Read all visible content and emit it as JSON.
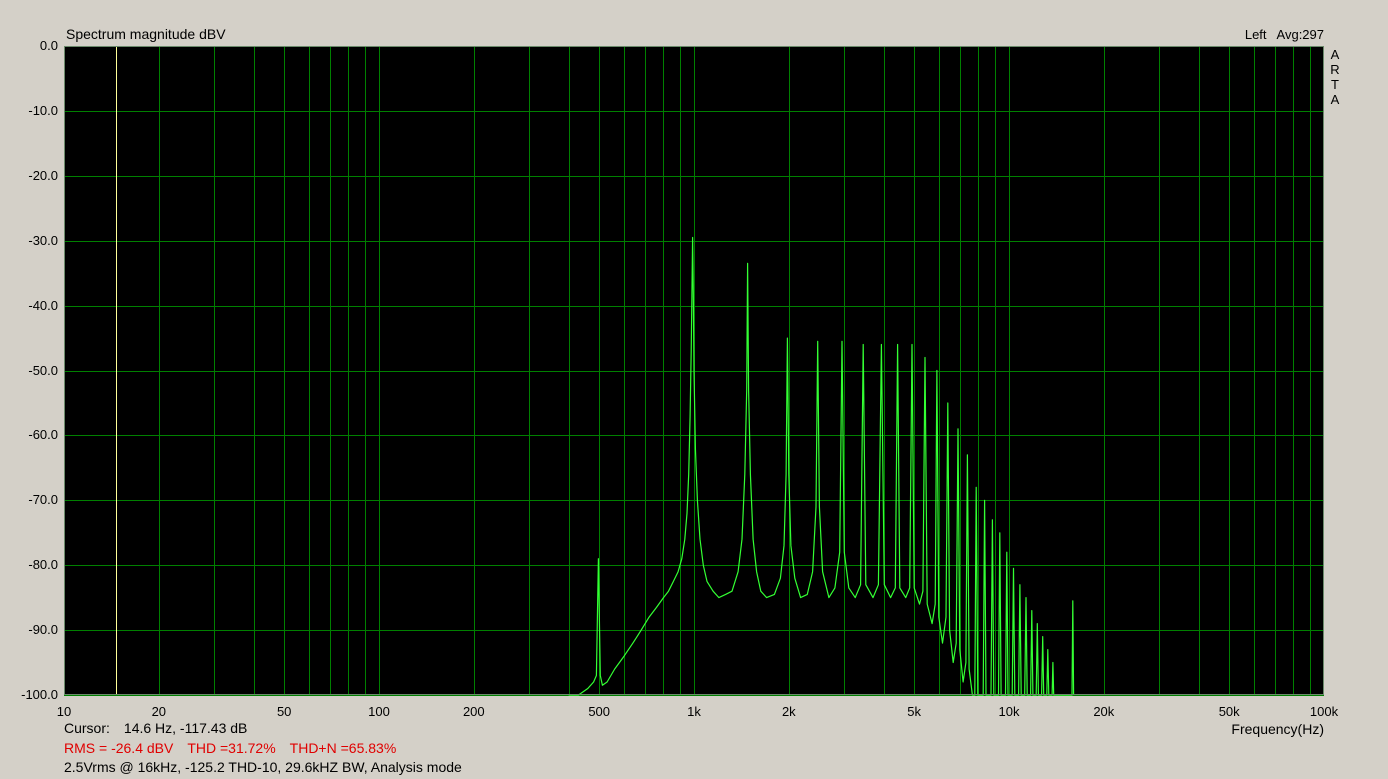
{
  "chart_data": {
    "type": "line",
    "title": "Spectrum magnitude dBV",
    "header_right": {
      "channel": "Left",
      "avg": "Avg:297"
    },
    "brand_vertical": [
      "A",
      "R",
      "T",
      "A"
    ],
    "xlabel": "Frequency(Hz)",
    "ylabel": "",
    "x_scale": "log",
    "xlim": [
      10,
      100000
    ],
    "ylim": [
      -100,
      0
    ],
    "x_ticks": [
      {
        "value": 10,
        "label": "10"
      },
      {
        "value": 20,
        "label": "20"
      },
      {
        "value": 50,
        "label": "50"
      },
      {
        "value": 100,
        "label": "100"
      },
      {
        "value": 200,
        "label": "200"
      },
      {
        "value": 500,
        "label": "500"
      },
      {
        "value": 1000,
        "label": "1k"
      },
      {
        "value": 2000,
        "label": "2k"
      },
      {
        "value": 5000,
        "label": "5k"
      },
      {
        "value": 10000,
        "label": "10k"
      },
      {
        "value": 20000,
        "label": "20k"
      },
      {
        "value": 50000,
        "label": "50k"
      },
      {
        "value": 100000,
        "label": "100k"
      }
    ],
    "y_ticks": [
      {
        "value": 0,
        "label": "0.0"
      },
      {
        "value": -10,
        "label": "-10.0"
      },
      {
        "value": -20,
        "label": "-20.0"
      },
      {
        "value": -30,
        "label": "-30.0"
      },
      {
        "value": -40,
        "label": "-40.0"
      },
      {
        "value": -50,
        "label": "-50.0"
      },
      {
        "value": -60,
        "label": "-60.0"
      },
      {
        "value": -70,
        "label": "-70.0"
      },
      {
        "value": -80,
        "label": "-80.0"
      },
      {
        "value": -90,
        "label": "-90.0"
      },
      {
        "value": -100,
        "label": "-100.0"
      }
    ],
    "grid": true,
    "cursor_frequency": 14.6,
    "colors": {
      "background": "#000000",
      "grid": "#008000",
      "trace": "#33ff33",
      "cursor": "#ffff99",
      "window": "#d4d0c8",
      "stats_text": "#e00000"
    },
    "series": [
      {
        "values": [
          [
            400,
            -100
          ],
          [
            430,
            -100
          ],
          [
            460,
            -99
          ],
          [
            480,
            -98
          ],
          [
            490,
            -97
          ],
          [
            497,
            -79
          ],
          [
            504,
            -97
          ],
          [
            512,
            -98.5
          ],
          [
            530,
            -98
          ],
          [
            560,
            -96
          ],
          [
            600,
            -94
          ],
          [
            640,
            -92
          ],
          [
            680,
            -90
          ],
          [
            720,
            -88
          ],
          [
            760,
            -86.5
          ],
          [
            800,
            -85
          ],
          [
            830,
            -84
          ],
          [
            860,
            -82.5
          ],
          [
            890,
            -81
          ],
          [
            915,
            -79
          ],
          [
            935,
            -76
          ],
          [
            950,
            -72
          ],
          [
            962,
            -66
          ],
          [
            972,
            -57
          ],
          [
            980,
            -47
          ],
          [
            985,
            -38.5
          ],
          [
            990,
            -29.5
          ],
          [
            995,
            -38
          ],
          [
            1000,
            -50
          ],
          [
            1010,
            -62
          ],
          [
            1025,
            -70
          ],
          [
            1045,
            -76
          ],
          [
            1070,
            -80
          ],
          [
            1100,
            -82.5
          ],
          [
            1150,
            -84
          ],
          [
            1200,
            -85
          ],
          [
            1260,
            -84.5
          ],
          [
            1320,
            -84
          ],
          [
            1380,
            -81
          ],
          [
            1420,
            -76
          ],
          [
            1450,
            -66
          ],
          [
            1470,
            -53
          ],
          [
            1480,
            -33.5
          ],
          [
            1490,
            -53
          ],
          [
            1510,
            -66
          ],
          [
            1540,
            -76
          ],
          [
            1580,
            -81
          ],
          [
            1630,
            -84
          ],
          [
            1700,
            -85
          ],
          [
            1800,
            -84.5
          ],
          [
            1880,
            -82
          ],
          [
            1930,
            -77
          ],
          [
            1960,
            -66
          ],
          [
            1980,
            -45
          ],
          [
            2000,
            -66
          ],
          [
            2030,
            -77
          ],
          [
            2090,
            -82
          ],
          [
            2180,
            -85
          ],
          [
            2290,
            -84.5
          ],
          [
            2380,
            -81
          ],
          [
            2440,
            -71
          ],
          [
            2470,
            -45.5
          ],
          [
            2500,
            -71
          ],
          [
            2560,
            -81
          ],
          [
            2680,
            -85
          ],
          [
            2800,
            -83.5
          ],
          [
            2900,
            -78
          ],
          [
            2950,
            -45.5
          ],
          [
            3000,
            -78
          ],
          [
            3100,
            -83.5
          ],
          [
            3250,
            -85
          ],
          [
            3380,
            -83
          ],
          [
            3445,
            -46
          ],
          [
            3510,
            -83
          ],
          [
            3700,
            -85
          ],
          [
            3850,
            -83
          ],
          [
            3935,
            -46
          ],
          [
            4020,
            -83
          ],
          [
            4210,
            -85
          ],
          [
            4355,
            -83.5
          ],
          [
            4430,
            -46
          ],
          [
            4500,
            -83.5
          ],
          [
            4700,
            -85
          ],
          [
            4840,
            -83.5
          ],
          [
            4920,
            -46
          ],
          [
            5000,
            -83.5
          ],
          [
            5200,
            -86
          ],
          [
            5330,
            -84
          ],
          [
            5410,
            -48
          ],
          [
            5500,
            -86
          ],
          [
            5700,
            -89
          ],
          [
            5830,
            -86
          ],
          [
            5905,
            -50
          ],
          [
            5985,
            -88
          ],
          [
            6150,
            -92
          ],
          [
            6310,
            -88
          ],
          [
            6395,
            -55
          ],
          [
            6480,
            -90
          ],
          [
            6650,
            -95
          ],
          [
            6800,
            -92
          ],
          [
            6890,
            -59
          ],
          [
            6980,
            -93
          ],
          [
            7150,
            -98
          ],
          [
            7300,
            -95
          ],
          [
            7380,
            -63
          ],
          [
            7470,
            -96
          ],
          [
            7650,
            -100
          ],
          [
            7790,
            -100
          ],
          [
            7870,
            -68
          ],
          [
            7960,
            -100
          ],
          [
            8280,
            -100
          ],
          [
            8365,
            -70
          ],
          [
            8450,
            -100
          ],
          [
            8770,
            -100
          ],
          [
            8860,
            -73
          ],
          [
            8950,
            -100
          ],
          [
            9260,
            -100
          ],
          [
            9350,
            -75
          ],
          [
            9440,
            -100
          ],
          [
            9750,
            -100
          ],
          [
            9840,
            -78
          ],
          [
            9930,
            -100
          ],
          [
            10240,
            -100
          ],
          [
            10335,
            -80.5
          ],
          [
            10430,
            -100
          ],
          [
            10730,
            -100
          ],
          [
            10830,
            -83
          ],
          [
            10930,
            -100
          ],
          [
            11220,
            -100
          ],
          [
            11320,
            -85
          ],
          [
            11420,
            -100
          ],
          [
            11710,
            -100
          ],
          [
            11810,
            -87
          ],
          [
            11910,
            -100
          ],
          [
            12200,
            -100
          ],
          [
            12300,
            -89
          ],
          [
            12400,
            -100
          ],
          [
            12690,
            -100
          ],
          [
            12790,
            -91
          ],
          [
            12890,
            -100
          ],
          [
            13180,
            -100
          ],
          [
            13280,
            -93
          ],
          [
            13380,
            -100
          ],
          [
            13700,
            -100
          ],
          [
            13780,
            -95
          ],
          [
            13860,
            -100
          ],
          [
            13900,
            -100
          ],
          [
            15850,
            -100
          ],
          [
            15940,
            -85.5
          ],
          [
            16030,
            -100
          ]
        ]
      }
    ]
  },
  "footer": {
    "cursor_label": "Cursor:",
    "cursor_value": "14.6 Hz, -117.43 dB",
    "rms": "RMS =  -26.4 dBV",
    "thd": "THD =31.72%",
    "thdn": "THD+N =65.83%",
    "description": "2.5Vrms @ 16kHz, -125.2 THD-10,  29.6kHZ BW, Analysis mode"
  }
}
